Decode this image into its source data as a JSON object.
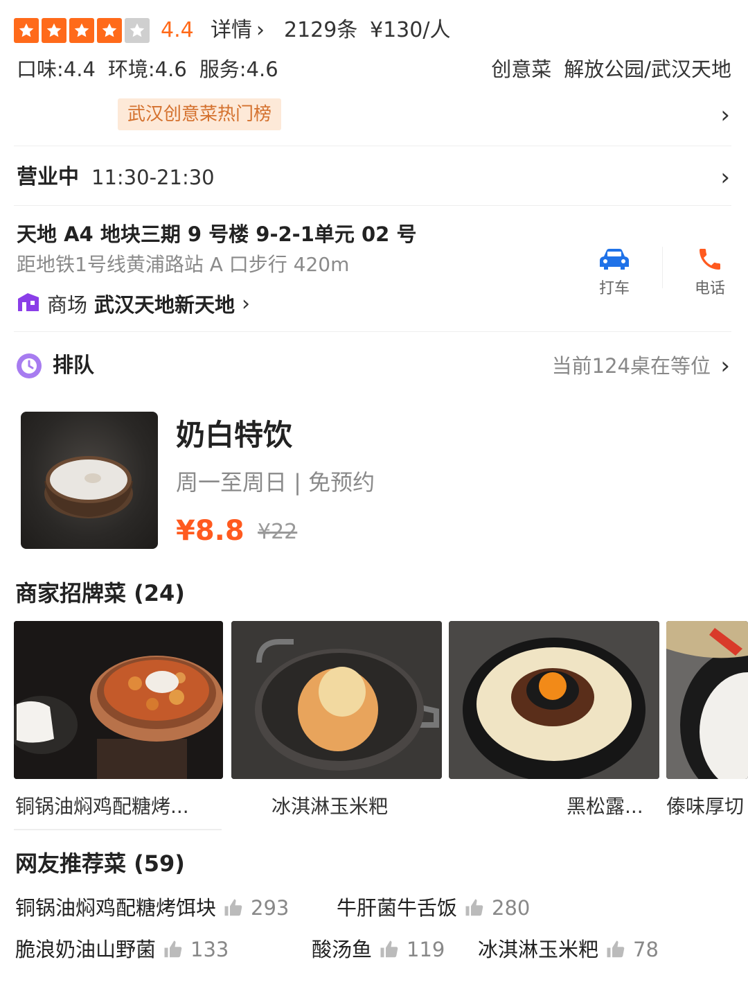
{
  "rating": {
    "stars_filled": 4,
    "stars_total": 5,
    "score": "4.4",
    "details_label": "详情",
    "reviews_count": "2129条",
    "price_per_person": "¥130/人"
  },
  "scores": {
    "taste": "口味:4.4",
    "environment": "环境:4.6",
    "service": "服务:4.6"
  },
  "tags": {
    "cuisine": "创意菜",
    "area": "解放公园/武汉天地"
  },
  "rank_badge": "武汉创意菜热门榜",
  "hours": {
    "status": "营业中",
    "time": "11:30-21:30"
  },
  "address": {
    "line": "天地 A4 地块三期 9 号楼 9-2-1单元 02 号",
    "metro": "距地铁1号线黄浦路站 A 口步行 420m",
    "mall_label": "商场",
    "mall_name": "武汉天地新天地"
  },
  "actions": {
    "taxi": "打车",
    "phone": "电话"
  },
  "queue": {
    "title": "排队",
    "status": "当前124桌在等位"
  },
  "deal": {
    "title": "奶白特饮",
    "subtitle": "周一至周日 | 免预约",
    "price": "¥8.8",
    "original_price": "¥22"
  },
  "signature": {
    "title": "商家招牌菜 (24)",
    "dishes": [
      {
        "name": "铜锅油焖鸡配糖烤..."
      },
      {
        "name": "冰淇淋玉米粑"
      },
      {
        "name": "黑松露..."
      },
      {
        "name": "傣味厚切"
      }
    ]
  },
  "recommended": {
    "title": "网友推荐菜 (59)",
    "items": [
      {
        "name": "铜锅油焖鸡配糖烤饵块",
        "count": "293"
      },
      {
        "name": "牛肝菌牛舌饭",
        "count": "280"
      },
      {
        "name": "脆浪奶油山野菌",
        "count": "133"
      },
      {
        "name": "酸汤鱼",
        "count": "119"
      },
      {
        "name": "冰淇淋玉米粑",
        "count": "78"
      }
    ]
  },
  "colors": {
    "accent": "#ff6a1a",
    "price": "#ff5a1f",
    "badge_bg": "#fde9d8",
    "badge_text": "#d4712e",
    "taxi_icon": "#1f72e8",
    "phone_icon": "#ff5a1f",
    "mall_icon": "#8a3ee8",
    "queue_icon": "#a77cf0"
  },
  "icons": [
    "star-icon",
    "chevron-right-icon",
    "car-icon",
    "phone-icon",
    "mall-icon",
    "clock-icon",
    "thumbs-up-icon"
  ]
}
